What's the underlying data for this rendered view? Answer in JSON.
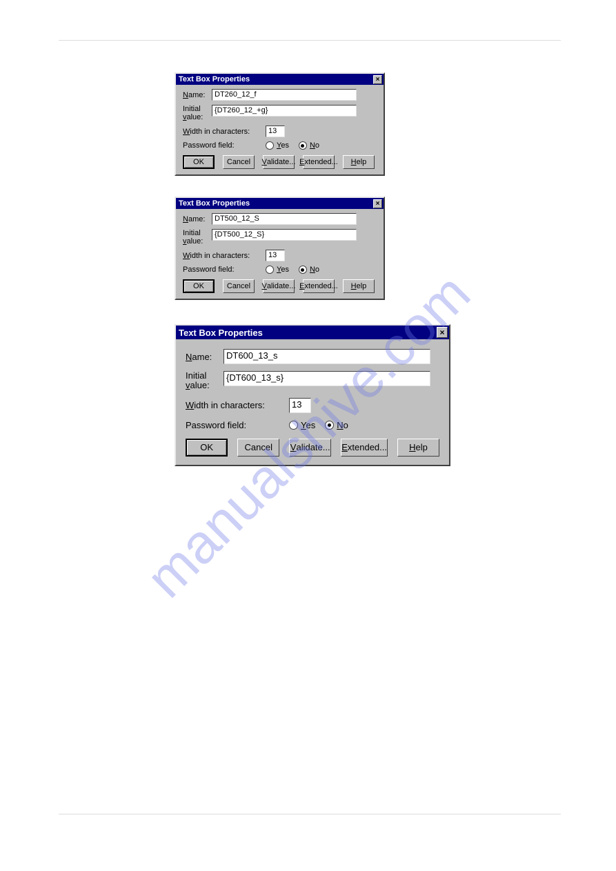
{
  "watermark": "manualshive.com",
  "dialogs": [
    {
      "title": "Text Box Properties",
      "labels": {
        "name_u": "N",
        "name_r": "ame:",
        "initial": "Initial",
        "value_u": "v",
        "value_r": "alue:",
        "width_u": "W",
        "width_r": "idth in characters:",
        "password": "Password field:",
        "yes_u": "Y",
        "yes_r": "es",
        "no_u": "N",
        "no_r": "o"
      },
      "values": {
        "name": "DT260_12_f",
        "initial_value": "{DT260_12_+g}",
        "width": "13",
        "password_selected": "no"
      },
      "buttons": {
        "ok": "OK",
        "cancel": "Cancel",
        "validate_u": "V",
        "validate_r": "alidate...",
        "extended_u": "E",
        "extended_r": "xtended...",
        "help_u": "H",
        "help_r": "elp"
      }
    },
    {
      "title": "Text Box Properties",
      "labels": {
        "name_u": "N",
        "name_r": "ame:",
        "initial": "Initial",
        "value_u": "v",
        "value_r": "alue:",
        "width_u": "W",
        "width_r": "idth in characters:",
        "password": "Password field:",
        "yes_u": "Y",
        "yes_r": "es",
        "no_u": "N",
        "no_r": "o"
      },
      "values": {
        "name": "DT500_12_S",
        "initial_value": "{DT500_12_S}",
        "width": "13",
        "password_selected": "no"
      },
      "buttons": {
        "ok": "OK",
        "cancel": "Cancel",
        "validate_u": "V",
        "validate_r": "alidate...",
        "extended_u": "E",
        "extended_r": "xtended...",
        "help_u": "H",
        "help_r": "elp"
      }
    },
    {
      "title": "Text Box Properties",
      "labels": {
        "name_u": "N",
        "name_r": "ame:",
        "initial": "Initial",
        "value_u": "v",
        "value_r": "alue:",
        "width_u": "W",
        "width_r": "idth in characters:",
        "password": "Password field:",
        "yes_u": "Y",
        "yes_r": "es",
        "no_u": "N",
        "no_r": "o"
      },
      "values": {
        "name": "DT600_13_s",
        "initial_value": "{DT600_13_s}",
        "width": "13",
        "password_selected": "no"
      },
      "buttons": {
        "ok": "OK",
        "cancel": "Cancel",
        "validate_u": "V",
        "validate_r": "alidate...",
        "extended_u": "E",
        "extended_r": "xtended...",
        "help_u": "H",
        "help_r": "elp"
      }
    }
  ]
}
